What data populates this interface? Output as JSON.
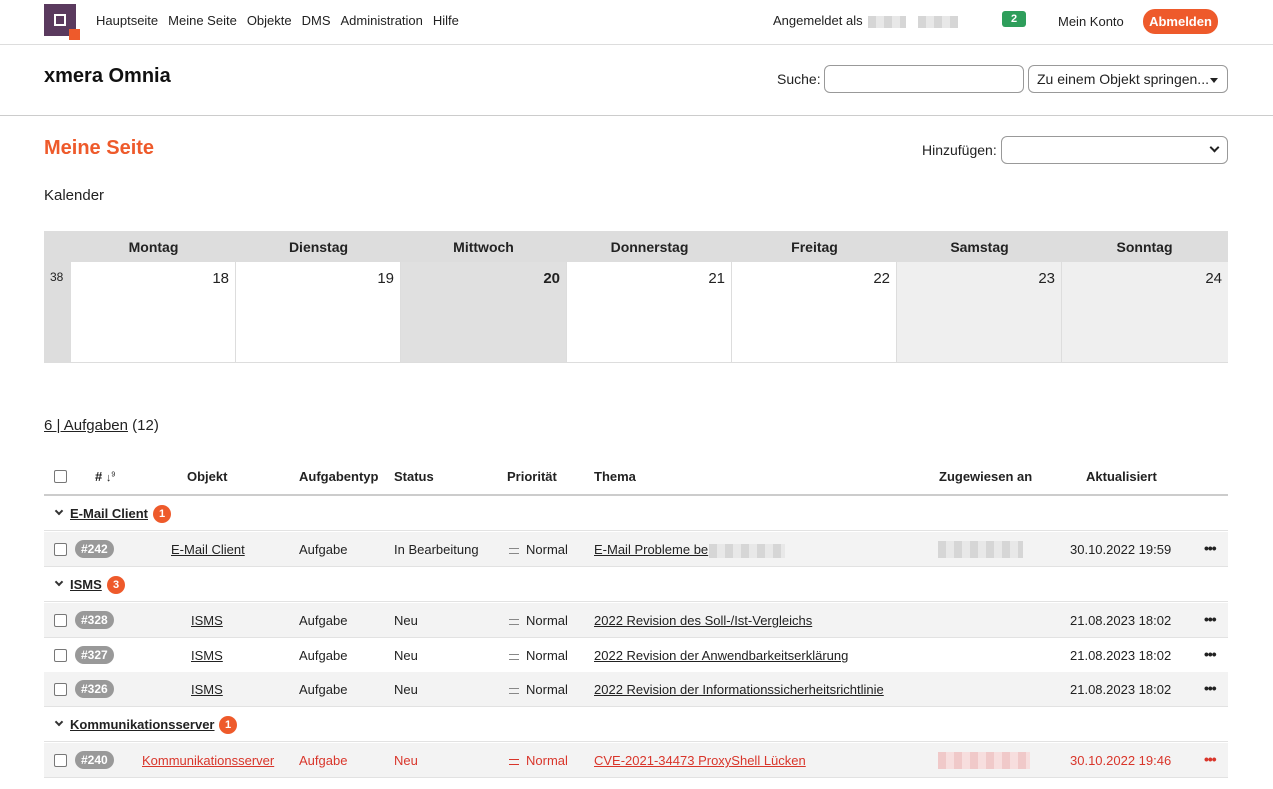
{
  "nav": {
    "items": [
      "Hauptseite",
      "Meine Seite",
      "Objekte",
      "DMS",
      "Administration",
      "Hilfe"
    ],
    "logged_in_label": "Angemeldet als",
    "notifications": "2",
    "account": "Mein Konto",
    "logout": "Abmelden"
  },
  "header": {
    "title": "xmera Omnia",
    "search_label": "Suche:",
    "jump_placeholder": "Zu einem Objekt springen..."
  },
  "page": {
    "title": "Meine Seite",
    "add_label": "Hinzufügen:"
  },
  "calendar": {
    "title": "Kalender",
    "week": "38",
    "days": [
      "Montag",
      "Dienstag",
      "Mittwoch",
      "Donnerstag",
      "Freitag",
      "Samstag",
      "Sonntag"
    ],
    "dates": [
      "18",
      "19",
      "20",
      "21",
      "22",
      "23",
      "24"
    ]
  },
  "tasks": {
    "link_text": "6 | Aufgaben",
    "count": "(12)",
    "columns": {
      "id": "#",
      "object": "Objekt",
      "type": "Aufgabentyp",
      "status": "Status",
      "priority": "Priorität",
      "subject": "Thema",
      "assigned": "Zugewiesen an",
      "updated": "Aktualisiert"
    },
    "groups": [
      {
        "name": "E-Mail Client",
        "count": "1"
      },
      {
        "name": "ISMS",
        "count": "3"
      },
      {
        "name": "Kommunikationsserver",
        "count": "1"
      }
    ],
    "rows": [
      {
        "id": "#242",
        "object": "E-Mail Client",
        "type": "Aufgabe",
        "status": "In Bearbeitung",
        "priority": "Normal",
        "subject": "E-Mail Probleme be",
        "updated": "30.10.2022 19:59"
      },
      {
        "id": "#328",
        "object": "ISMS",
        "type": "Aufgabe",
        "status": "Neu",
        "priority": "Normal",
        "subject": "2022 Revision des Soll-/Ist-Vergleichs",
        "updated": "21.08.2023 18:02"
      },
      {
        "id": "#327",
        "object": "ISMS",
        "type": "Aufgabe",
        "status": "Neu",
        "priority": "Normal",
        "subject": "2022 Revision der Anwendbarkeitserklärung",
        "updated": "21.08.2023 18:02"
      },
      {
        "id": "#326",
        "object": "ISMS",
        "type": "Aufgabe",
        "status": "Neu",
        "priority": "Normal",
        "subject": "2022 Revision der Informationssicherheitsrichtlinie",
        "updated": "21.08.2023 18:02"
      },
      {
        "id": "#240",
        "object": "Kommunikationsserver",
        "type": "Aufgabe",
        "status": "Neu",
        "priority": "Normal",
        "subject": "CVE-2021-34473 ProxyShell Lücken",
        "updated": "30.10.2022 19:46"
      }
    ]
  },
  "colors": {
    "accent": "#ee5a2b",
    "brand": "#5a3a5e",
    "overdue": "#d9362b",
    "badge": "#2e9e5b"
  }
}
